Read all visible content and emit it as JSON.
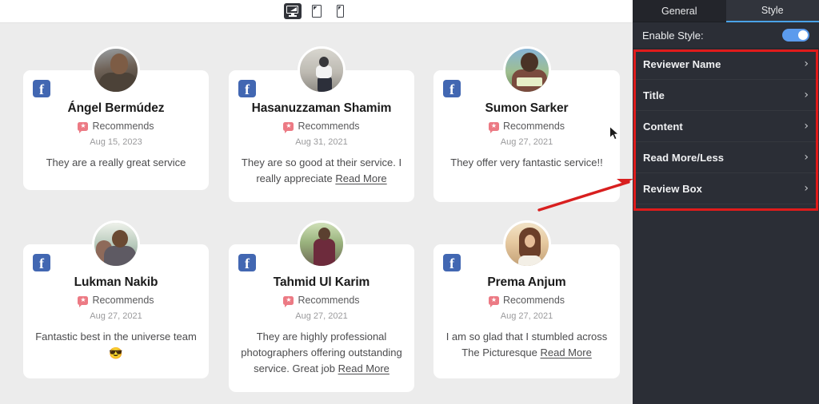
{
  "preview": {
    "toolbar": {
      "devices": [
        {
          "name": "desktop",
          "label": "Desktop",
          "active": true
        },
        {
          "name": "tablet",
          "label": "Tablet",
          "active": false
        },
        {
          "name": "mobile",
          "label": "Mobile",
          "active": false
        }
      ]
    },
    "cards": [
      {
        "id": "angel-bermudez",
        "source": "facebook",
        "name": "Ángel Bermúdez",
        "recommends": "Recommends",
        "date": "Aug 15, 2023",
        "content": "They are a really great service",
        "read_more": "",
        "emoji": ""
      },
      {
        "id": "hasanuzzaman-shamim",
        "source": "facebook",
        "name": "Hasanuzzaman Shamim",
        "recommends": "Recommends",
        "date": "Aug 31, 2021",
        "content": "They are so good at their service. I really appreciate ",
        "read_more": "Read More",
        "emoji": ""
      },
      {
        "id": "sumon-sarker",
        "source": "facebook",
        "name": "Sumon Sarker",
        "recommends": "Recommends",
        "date": "Aug 27, 2021",
        "content": "They offer very fantastic service!!",
        "read_more": "",
        "emoji": ""
      },
      {
        "id": "lukman-nakib",
        "source": "facebook",
        "name": "Lukman Nakib",
        "recommends": "Recommends",
        "date": "Aug 27, 2021",
        "content": "Fantastic best in the universe team",
        "read_more": "",
        "emoji": "😎"
      },
      {
        "id": "tahmid-ul-karim",
        "source": "facebook",
        "name": "Tahmid Ul Karim",
        "recommends": "Recommends",
        "date": "Aug 27, 2021",
        "content": "They are highly professional photographers offering outstanding service. Great job ",
        "read_more": "Read More",
        "emoji": ""
      },
      {
        "id": "prema-anjum",
        "source": "facebook",
        "name": "Prema Anjum",
        "recommends": "Recommends",
        "date": "Aug 27, 2021",
        "content": "I am so glad that I stumbled across The Picturesque ",
        "read_more": "Read More",
        "emoji": ""
      }
    ]
  },
  "sidebar": {
    "tabs": [
      {
        "label": "General",
        "active": false
      },
      {
        "label": "Style",
        "active": true
      }
    ],
    "enable_style": {
      "label": "Enable Style:",
      "value": "on"
    },
    "sections": [
      {
        "label": "Reviewer Name",
        "chevron": "›"
      },
      {
        "label": "Title",
        "chevron": "›"
      },
      {
        "label": "Content",
        "chevron": "›"
      },
      {
        "label": "Read More/Less",
        "chevron": "›"
      },
      {
        "label": "Review Box",
        "chevron": "›"
      }
    ]
  },
  "annotations": {
    "highlight_color": "#e01b1b",
    "arrow_color": "#d81f1f"
  },
  "colors": {
    "canvas_bg": "#ececec",
    "card_bg": "#ffffff",
    "sidebar_bg": "#2b2e36",
    "tab_active_underline": "#4aa3e8",
    "toggle_on": "#5b9bed",
    "facebook_blue": "#4267b2",
    "recommend_badge": "#ec7a84"
  }
}
